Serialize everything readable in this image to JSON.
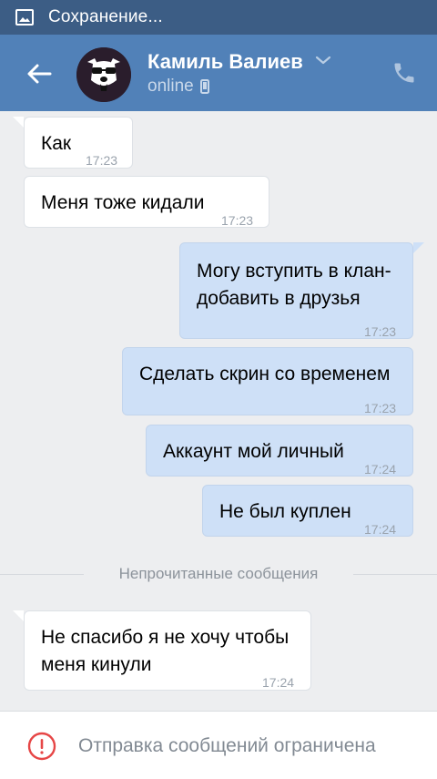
{
  "statusbar": {
    "text": "Сохранение..."
  },
  "header": {
    "name": "Камиль Валиев",
    "status": "online"
  },
  "messages": [
    {
      "dir": "in",
      "lines": [
        "Как"
      ],
      "time": "17:23"
    },
    {
      "dir": "in",
      "lines": [
        "Меня тоже кидали"
      ],
      "time": "17:23"
    },
    {
      "dir": "out",
      "lines": [
        "Могу вступить в клан-",
        "добавить в друзья"
      ],
      "time": "17:23"
    },
    {
      "dir": "out",
      "lines": [
        "Сделать скрин со временем"
      ],
      "time": "17:23"
    },
    {
      "dir": "out",
      "lines": [
        "Аккаунт мой личный"
      ],
      "time": "17:24"
    },
    {
      "dir": "out",
      "lines": [
        "Не был куплен"
      ],
      "time": "17:24"
    },
    {
      "dir": "in",
      "lines": [
        "Не спасибо я не хочу чтобы",
        "меня кинули"
      ],
      "time": "17:24"
    }
  ],
  "divider": {
    "label": "Непрочитанные сообщения"
  },
  "footer": {
    "text": "Отправка сообщений ограничена"
  },
  "colors": {
    "header": "#5181b8",
    "statusbar": "#3c5d85",
    "outgoing": "#cee0f7",
    "incoming": "#ffffff",
    "warning": "#e64646"
  },
  "icons": [
    "image-icon",
    "back-arrow-icon",
    "dog-avatar",
    "chevron-down-icon",
    "mobile-icon",
    "phone-icon",
    "warning-icon"
  ]
}
